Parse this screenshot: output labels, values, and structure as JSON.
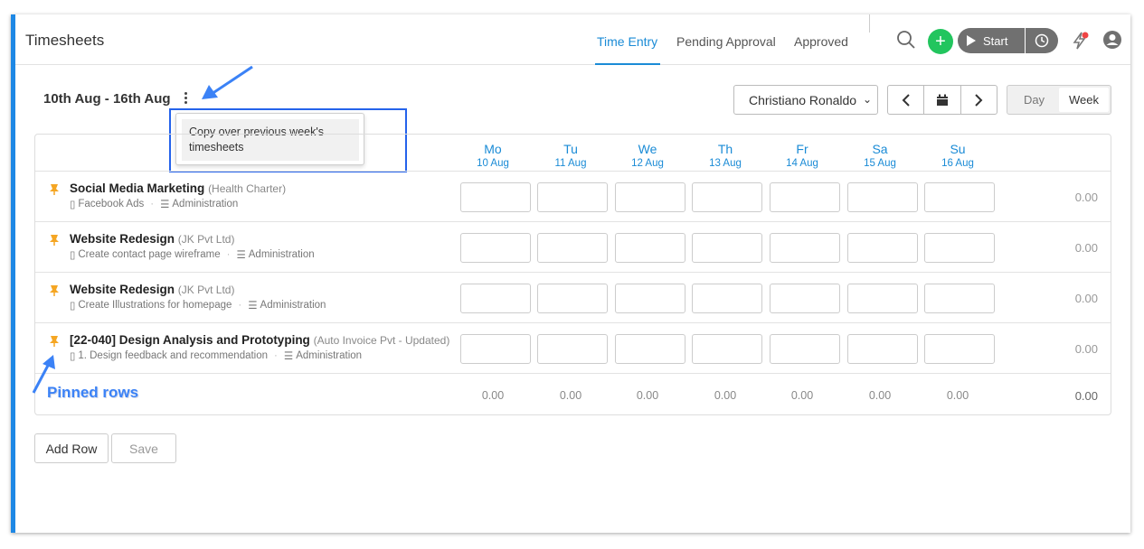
{
  "header": {
    "title": "Timesheets",
    "tabs": [
      {
        "label": "Time Entry",
        "active": true
      },
      {
        "label": "Pending Approval",
        "active": false
      },
      {
        "label": "Approved",
        "active": false
      }
    ],
    "start_label": "Start",
    "icons": [
      "search-icon",
      "plus-icon",
      "play-icon",
      "clock-icon",
      "bolt-icon",
      "user-icon"
    ]
  },
  "toolbar": {
    "date_range": "10th Aug - 16th Aug",
    "menu_item": "Copy over previous week's timesheets",
    "user_select_value": "Christiano Ronaldo",
    "view_options": [
      {
        "label": "Day",
        "active": false
      },
      {
        "label": "Week",
        "active": true
      }
    ]
  },
  "days": [
    {
      "day": "Mo",
      "date": "10 Aug"
    },
    {
      "day": "Tu",
      "date": "11 Aug"
    },
    {
      "day": "We",
      "date": "12 Aug"
    },
    {
      "day": "Th",
      "date": "13 Aug"
    },
    {
      "day": "Fr",
      "date": "14 Aug"
    },
    {
      "day": "Sa",
      "date": "15 Aug"
    },
    {
      "day": "Su",
      "date": "16 Aug"
    }
  ],
  "rows": [
    {
      "project": "Social Media Marketing",
      "client": "(Health Charter)",
      "task": "Facebook Ads",
      "category": "Administration",
      "total": "0.00"
    },
    {
      "project": "Website Redesign",
      "client": "(JK Pvt Ltd)",
      "task": "Create contact page wireframe",
      "category": "Administration",
      "total": "0.00"
    },
    {
      "project": "Website Redesign",
      "client": "(JK Pvt Ltd)",
      "task": "Create Illustrations for homepage",
      "category": "Administration",
      "total": "0.00"
    },
    {
      "project": "[22-040] Design Analysis and Prototyping",
      "client": "(Auto Invoice Pvt - Updated)",
      "task": "1. Design feedback and recommendation",
      "category": "Administration",
      "total": "0.00"
    }
  ],
  "totals": {
    "days": [
      "0.00",
      "0.00",
      "0.00",
      "0.00",
      "0.00",
      "0.00",
      "0.00"
    ],
    "grand": "0.00"
  },
  "annotation": {
    "pinned_label": "Pinned rows"
  },
  "actions": {
    "add_row": "Add Row",
    "save": "Save"
  },
  "colors": {
    "accent": "#1a8bd6",
    "start_green": "#22c55e",
    "pin": "#f5a623",
    "annotation": "#3b82f6"
  }
}
